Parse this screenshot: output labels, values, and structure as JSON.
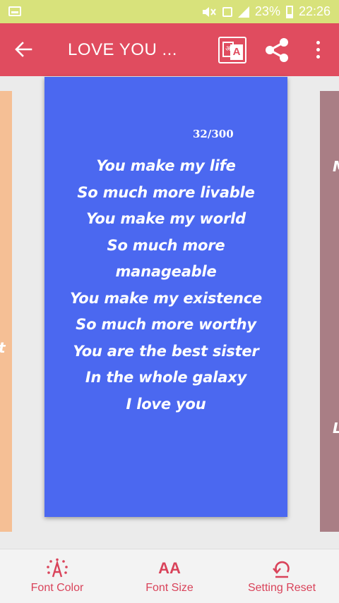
{
  "status_bar": {
    "battery": "23%",
    "time": "22:26",
    "icons": [
      "image-icon",
      "mute-icon",
      "sim-icon",
      "signal-icon",
      "battery-icon"
    ]
  },
  "app_bar": {
    "title": "LOVE YOU ...",
    "icons": [
      "back-arrow-icon",
      "translate-icon",
      "share-icon",
      "more-vert-icon"
    ],
    "translate_glyph": "अ",
    "translate_glyph_front": "A",
    "color": "#e04c5f"
  },
  "card": {
    "counter": "32/300",
    "background": "#4b68f0",
    "lines": [
      "You make my life",
      "So much more livable",
      "You make my world",
      "So much more",
      "manageable",
      "You make my existence",
      "So much more worthy",
      "You are the best sister",
      "In the whole galaxy",
      "I love you"
    ]
  },
  "side_cards": {
    "left_peek_letter": "t",
    "right_peek_letters": [
      "M",
      "L"
    ],
    "left_color": "#f5bf95",
    "right_color": "#a97e85"
  },
  "toolbar": {
    "font_color": "Font Color",
    "font_size": "Font Size",
    "setting_reset": "Setting Reset",
    "font_size_glyph": "AA",
    "accent": "#d9435a"
  }
}
